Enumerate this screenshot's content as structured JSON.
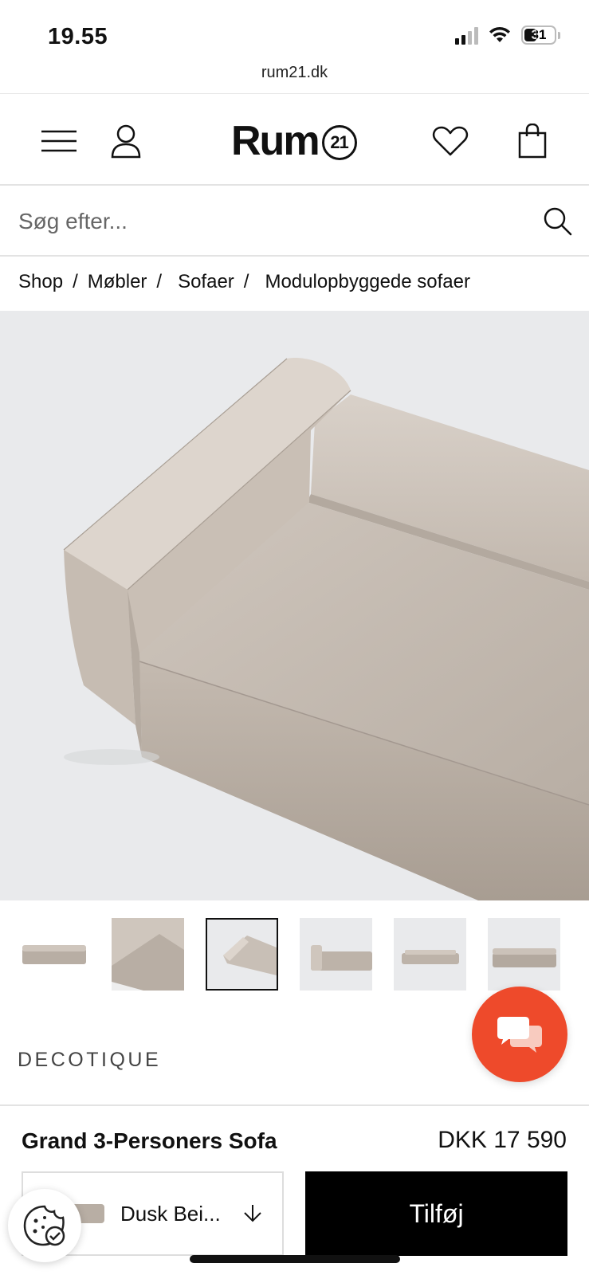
{
  "status_bar": {
    "time": "19.55",
    "battery": "31",
    "url": "rum21.dk"
  },
  "header": {
    "logo_text": "Rum",
    "logo_badge": "21"
  },
  "search": {
    "placeholder": "Søg efter..."
  },
  "breadcrumb": {
    "items": [
      "Shop",
      "Møbler",
      "Sofaer",
      "Modulopbyggede sofaer"
    ],
    "separator": "/"
  },
  "gallery": {
    "thumbnail_count": 6,
    "active_index": 2
  },
  "brand": "DECOTIQUE",
  "product": {
    "name": "Grand 3-Personers Sofa",
    "price": "DKK 17 590",
    "variant": "Dusk Bei...",
    "add_label": "Tilføj"
  },
  "icons": {
    "menu": "menu-icon",
    "account": "user-icon",
    "wishlist": "heart-icon",
    "cart": "bag-icon",
    "search": "search-icon",
    "chat": "chat-icon",
    "cookie": "cookie-icon"
  },
  "colors": {
    "chat_fab": "#ee4a2b",
    "add_button": "#000000",
    "sofa": "#c8bfb6"
  }
}
